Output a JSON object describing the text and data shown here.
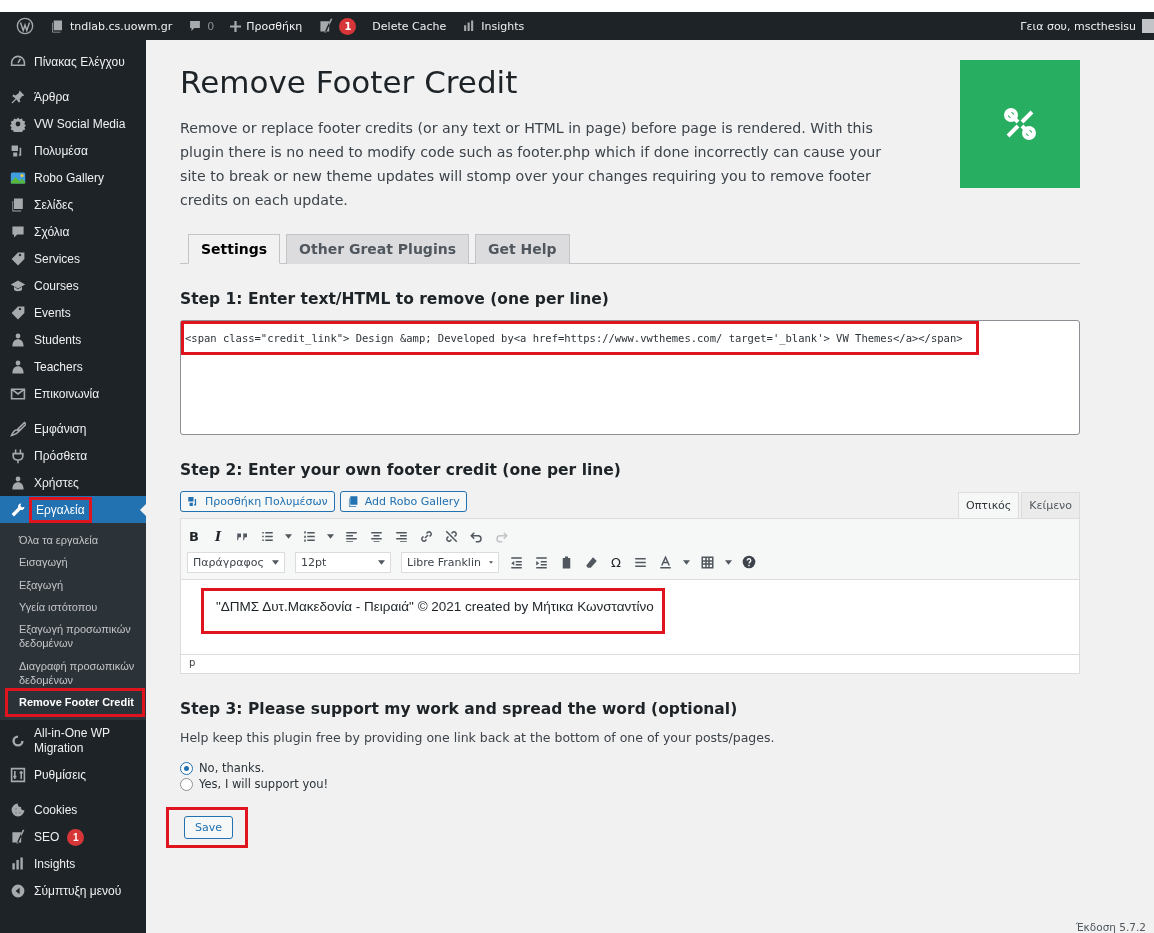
{
  "admin_bar": {
    "site": "tndlab.cs.uowm.gr",
    "comments": "0",
    "new": "Προσθήκη",
    "yoast_badge": "1",
    "delete_cache": "Delete Cache",
    "insights": "Insights",
    "greeting": "Γεια σου, mscthesisu"
  },
  "sidebar": {
    "groups": [
      [
        {
          "label": "Πίνακας Ελέγχου",
          "current": false,
          "annotated": false
        }
      ],
      [
        {
          "label": "Άρθρα",
          "current": false,
          "annotated": false
        },
        {
          "label": "VW Social Media",
          "current": false,
          "annotated": false
        },
        {
          "label": "Πολυμέσα",
          "current": false,
          "annotated": false
        },
        {
          "label": "Robo Gallery",
          "current": false,
          "annotated": false
        },
        {
          "label": "Σελίδες",
          "current": false,
          "annotated": false
        },
        {
          "label": "Σχόλια",
          "current": false,
          "annotated": false
        },
        {
          "label": "Services",
          "current": false,
          "annotated": false
        },
        {
          "label": "Courses",
          "current": false,
          "annotated": false
        },
        {
          "label": "Events",
          "current": false,
          "annotated": false
        },
        {
          "label": "Students",
          "current": false,
          "annotated": false
        },
        {
          "label": "Teachers",
          "current": false,
          "annotated": false
        },
        {
          "label": "Επικοινωνία",
          "current": false,
          "annotated": false
        }
      ],
      [
        {
          "label": "Εμφάνιση",
          "current": false,
          "annotated": false
        },
        {
          "label": "Πρόσθετα",
          "current": false,
          "annotated": false
        },
        {
          "label": "Χρήστες",
          "current": false,
          "annotated": false
        },
        {
          "label": "Εργαλεία",
          "current": true,
          "annotated": true,
          "children": [
            {
              "label": "Όλα τα εργαλεία",
              "selected": false,
              "annotated": false
            },
            {
              "label": "Εισαγωγή",
              "selected": false,
              "annotated": false
            },
            {
              "label": "Εξαγωγή",
              "selected": false,
              "annotated": false
            },
            {
              "label": "Υγεία ιστότοπου",
              "selected": false,
              "annotated": false
            },
            {
              "label": "Εξαγωγή προσωπικών δεδομένων",
              "selected": false,
              "annotated": false
            },
            {
              "label": "Διαγραφή προσωπικών δεδομένων",
              "selected": false,
              "annotated": false
            },
            {
              "label": "Remove Footer Credit",
              "selected": true,
              "annotated": true
            }
          ]
        },
        {
          "label": "All-in-One WP Migration",
          "current": false,
          "annotated": false
        },
        {
          "label": "Ρυθμίσεις",
          "current": false,
          "annotated": false
        }
      ],
      [
        {
          "label": "Cookies",
          "current": false,
          "annotated": false
        },
        {
          "label": "SEO",
          "badge": "1",
          "current": false,
          "annotated": false
        },
        {
          "label": "Insights",
          "current": false,
          "annotated": false
        },
        {
          "label": "Σύμπτυξη μενού",
          "current": false,
          "annotated": false
        }
      ]
    ]
  },
  "page": {
    "title": "Remove Footer Credit",
    "description": "Remove or replace footer credits (or any text or HTML in page) before page is rendered. With this plugin there is no need to modify code such as footer.php which if done incorrectly can cause your site to break or new theme updates will stomp over your changes requiring you to remove footer credits on each update.",
    "tabs": [
      {
        "label": "Settings",
        "selected": true
      },
      {
        "label": "Other Great Plugins",
        "selected": false
      },
      {
        "label": "Get Help",
        "selected": false
      }
    ],
    "step1": {
      "heading": "Step 1: Enter text/HTML to remove (one per line)",
      "value": "<span class=\"credit_link\"> Design &amp; Developed by<a href=https://www.vwthemes.com/ target='_blank'> VW Themes</a></span>",
      "annotated": true
    },
    "step2": {
      "heading": "Step 2: Enter your own footer credit (one per line)",
      "media_buttons": [
        "Προσθήκη Πολυμέσων",
        "Add Robo Gallery"
      ],
      "editor_tabs": [
        {
          "label": "Οπτικός",
          "selected": true
        },
        {
          "label": "Κείμενο",
          "selected": false
        }
      ],
      "toolbar_glyphs": [
        "B",
        "I",
        "Ω"
      ],
      "dropdowns": [
        "Παράγραφος",
        "12pt",
        "Libre Franklin"
      ],
      "content": "\"ΔΠΜΣ Δυτ.Μακεδονία - Πειραιά\" © 2021 created by Μήτικα Κωνσταντίνο",
      "annotated": true,
      "path": "p"
    },
    "step3": {
      "heading": "Step 3: Please support my work and spread the word (optional)",
      "help": "Help keep this plugin free by providing one link back at the bottom of one of your posts/pages.",
      "options": [
        {
          "label": "No, thanks.",
          "selected": true
        },
        {
          "label": "Yes, I will support you!",
          "selected": false
        }
      ]
    },
    "save": {
      "label": "Save",
      "annotated": true
    },
    "version": "Έκδοση 5.7.2"
  }
}
